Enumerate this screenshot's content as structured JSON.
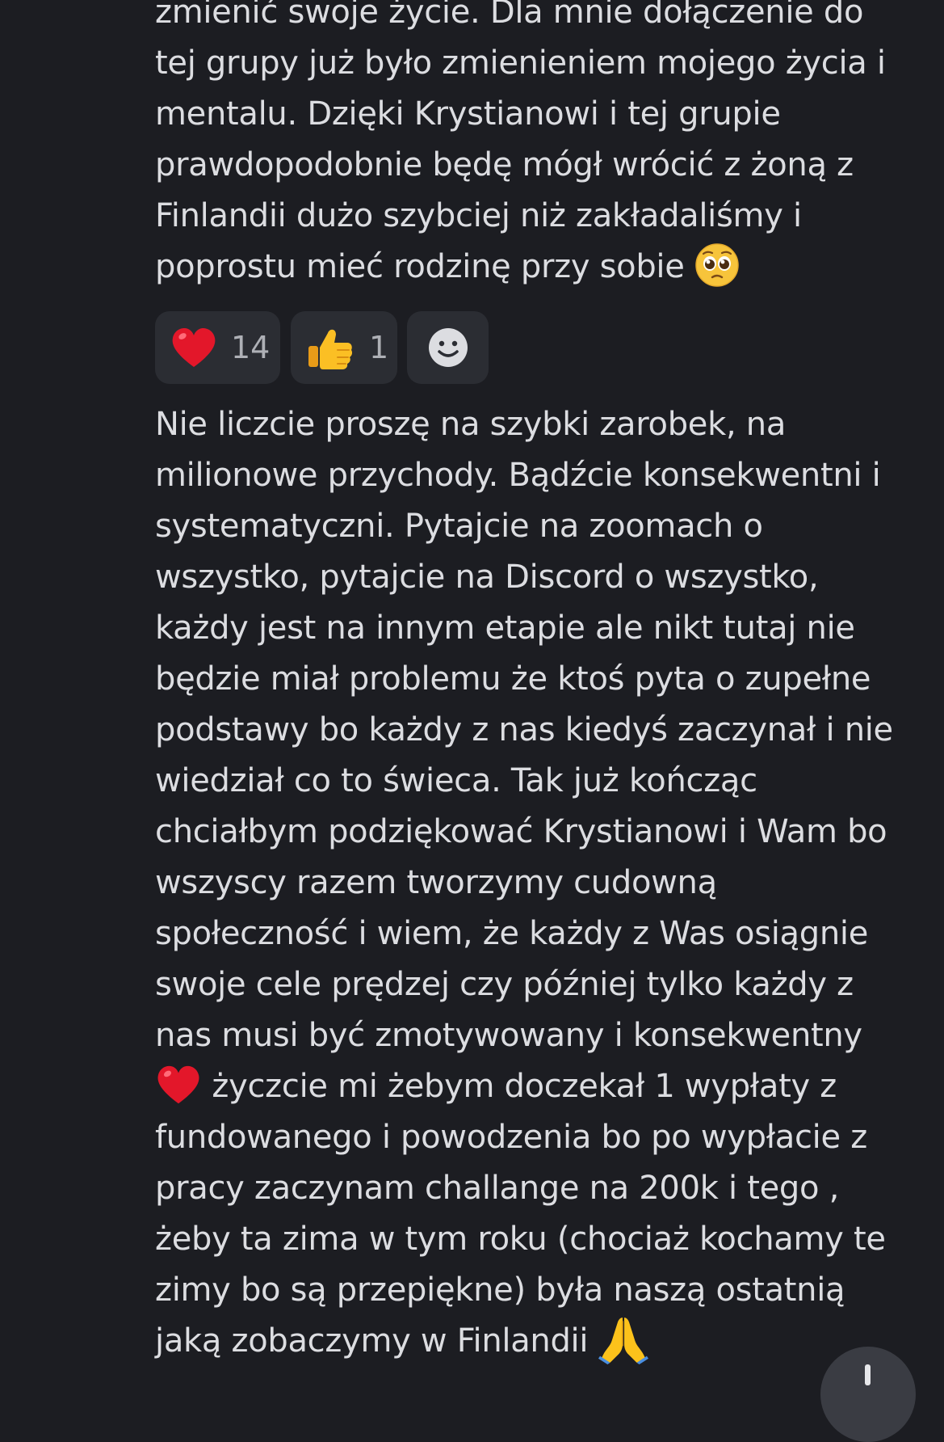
{
  "message1": {
    "lines": [
      "zmienić swoje życie. Dla mnie dołączenie do",
      "tej grupy już było zmienieniem mojego życia i",
      "mentalu. Dzięki Krystianowi i tej grupie",
      "prawdopodobnie będę mógł wrócić z żoną z",
      "Finlandii dużo szybciej niż zakładaliśmy i",
      "poprostu mieć rodzinę przy sobie"
    ],
    "trailing_emoji": "pleading-face-emoji"
  },
  "reactions": [
    {
      "emoji": "red-heart-emoji",
      "count": "14"
    },
    {
      "emoji": "thumbs-up-emoji",
      "count": "1"
    },
    {
      "emoji": "add-reaction-smiley-icon",
      "count": ""
    }
  ],
  "message2": {
    "lines": [
      "Nie liczcie proszę na szybki zarobek, na",
      "milionowe przychody. Bądźcie konsekwentni i",
      "systematyczni. Pytajcie na zoomach o",
      "wszystko, pytajcie na Discord o wszystko,",
      "każdy jest na innym etapie ale nikt tutaj nie",
      "będzie miał problemu że ktoś pyta o zupełne",
      "podstawy bo każdy z nas kiedyś zaczynał i nie",
      "wiedział co to świeca. Tak już kończąc",
      "chciałbym podziękować Krystianowi i Wam bo",
      "wszyscy razem tworzymy cudowną",
      "społeczność i wiem, że każdy z Was osiągnie",
      "swoje cele prędzej czy później tylko każdy z",
      "nas musi być zmotywowany i konsekwentny",
      " życzcie mi żebym doczekał 1 wypłaty z",
      "fundowanego i powodzenia bo po wypłacie z",
      "pracy zaczynam challange na 200k i tego ,",
      "żeby ta zima w tym roku (chociaż kochamy te",
      "zimy bo są przepiękne) była naszą ostatnią",
      "jaką zobaczymy w Finlandii"
    ],
    "inline_emojis": [
      "red-heart-emoji",
      "folded-hands-emoji"
    ]
  },
  "scroll_button": {
    "icon": "arrow-down-icon"
  },
  "colors": {
    "background": "#1c1d22",
    "text": "#dcdde1",
    "reaction_bg": "#2b2d33",
    "reaction_count": "#aeb0b6"
  }
}
